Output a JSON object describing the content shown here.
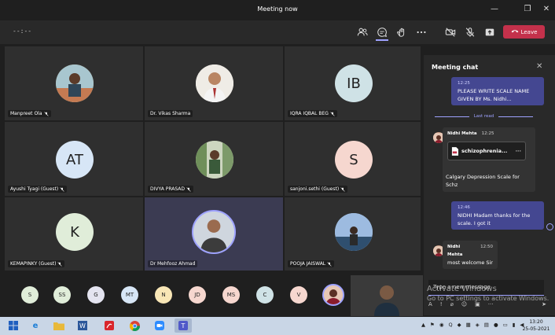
{
  "window": {
    "title": "Meeting now"
  },
  "toolbar": {
    "timer": "--:--",
    "leave_label": "Leave"
  },
  "colors": {
    "accent": "#9ea2ff",
    "leave": "#c4314b",
    "my_bubble": "#444791"
  },
  "participants": [
    {
      "name": "Manpreet Ola",
      "initials": "",
      "avatar_color": "#c8a26a"
    },
    {
      "name": "Dr. Vikas Sharma",
      "initials": "",
      "avatar_color": "#e9e4da"
    },
    {
      "name": "IQRA IQBAL BEG",
      "initials": "IB",
      "avatar_color": "#cfe2e6"
    },
    {
      "name": "Ayushi Tyagi (Guest)",
      "initials": "AT",
      "avatar_color": "#d7e6f6"
    },
    {
      "name": "DIVYA PRASAD",
      "initials": "",
      "avatar_color": "#8aa277"
    },
    {
      "name": "sanjoni.sethi (Guest)",
      "initials": "S",
      "avatar_color": "#f6d7cf"
    },
    {
      "name": "KEMAPINKY (Guest)",
      "initials": "K",
      "avatar_color": "#e0edd9"
    },
    {
      "name": "Dr Mehfooz Ahmad",
      "initials": "",
      "avatar_color": "#b9c8d8"
    },
    {
      "name": "POOJA JAISWAL",
      "initials": "",
      "avatar_color": "#8fb0d1"
    }
  ],
  "chat": {
    "title": "Meeting chat",
    "last_read": "Last read",
    "messages": [
      {
        "time": "12:25",
        "text": "PLEASE WRITE SCALE NAME GIVEN BY Ms. Nidhi..."
      },
      {
        "sender": "Nidhi Mehta",
        "time": "12:25",
        "file": "schizophrenia...",
        "text": "Calgary Depression Scale for Schz"
      },
      {
        "time": "12:46",
        "text": "NIDHI Madam thanks for the scale. I got it"
      },
      {
        "sender": "Nidhi Mehta",
        "time": "12:50",
        "text": "most welcome Sir"
      }
    ],
    "compose_placeholder": "Type a new message"
  },
  "watermark": {
    "line1": "Activate Windows",
    "line2": "Go to PC settings to activate Windows."
  },
  "roster": [
    {
      "initials": "S",
      "color": "#e0edd9"
    },
    {
      "initials": "SS",
      "color": "#e0edd9"
    },
    {
      "initials": "G",
      "color": "#e4e4f0"
    },
    {
      "initials": "MT",
      "color": "#d7e6f6"
    },
    {
      "initials": "N",
      "color": "#f8e6b6"
    },
    {
      "initials": "JD",
      "color": "#f6d7cf"
    },
    {
      "initials": "MS",
      "color": "#f6d7cf"
    },
    {
      "initials": "C",
      "color": "#cfe2e6"
    },
    {
      "initials": "V",
      "color": "#f6d7cf"
    }
  ],
  "taskbar": {
    "time": "13:20",
    "date": "25-05-2021"
  }
}
